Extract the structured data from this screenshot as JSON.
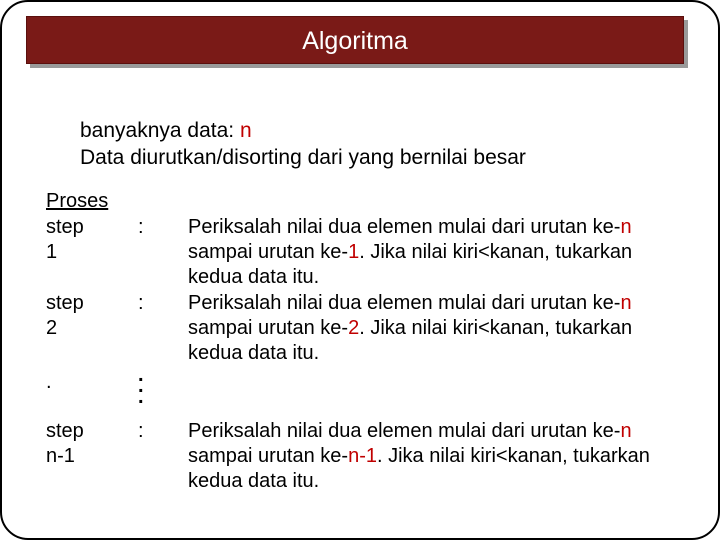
{
  "title": "Algoritma",
  "intro_line1_prefix": "banyaknya data:  ",
  "intro_line1_n": "n",
  "intro_line2": "Data diurutkan/disorting dari yang bernilai besar",
  "proses": "Proses",
  "steps": [
    {
      "label": "step 1",
      "colon": ":",
      "desc_a": "Periksalah nilai dua elemen mulai dari urutan ke-",
      "desc_b": "n",
      "desc_c": " sampai urutan ke-",
      "desc_d": "1",
      "desc_e": ". Jika nilai kiri<kanan, tukarkan kedua data itu."
    },
    {
      "label": "step 2",
      "colon": ":",
      "desc_a": "Periksalah nilai dua elemen mulai dari urutan ke-",
      "desc_b": "n",
      "desc_c": " sampai urutan ke-",
      "desc_d": "2",
      "desc_e": ". Jika nilai kiri<kanan, tukarkan kedua data itu."
    },
    {
      "label": "step n-1",
      "colon": ":",
      "desc_a": "Periksalah nilai dua elemen mulai dari urutan ke-",
      "desc_b": "n",
      "desc_c": " sampai urutan ke-",
      "desc_d": "n-1",
      "desc_e": ". Jika nilai kiri<kanan, tukarkan kedua data itu."
    }
  ],
  "dot": ".",
  "vd1": ".",
  "vd2": ".",
  "vd3": "."
}
